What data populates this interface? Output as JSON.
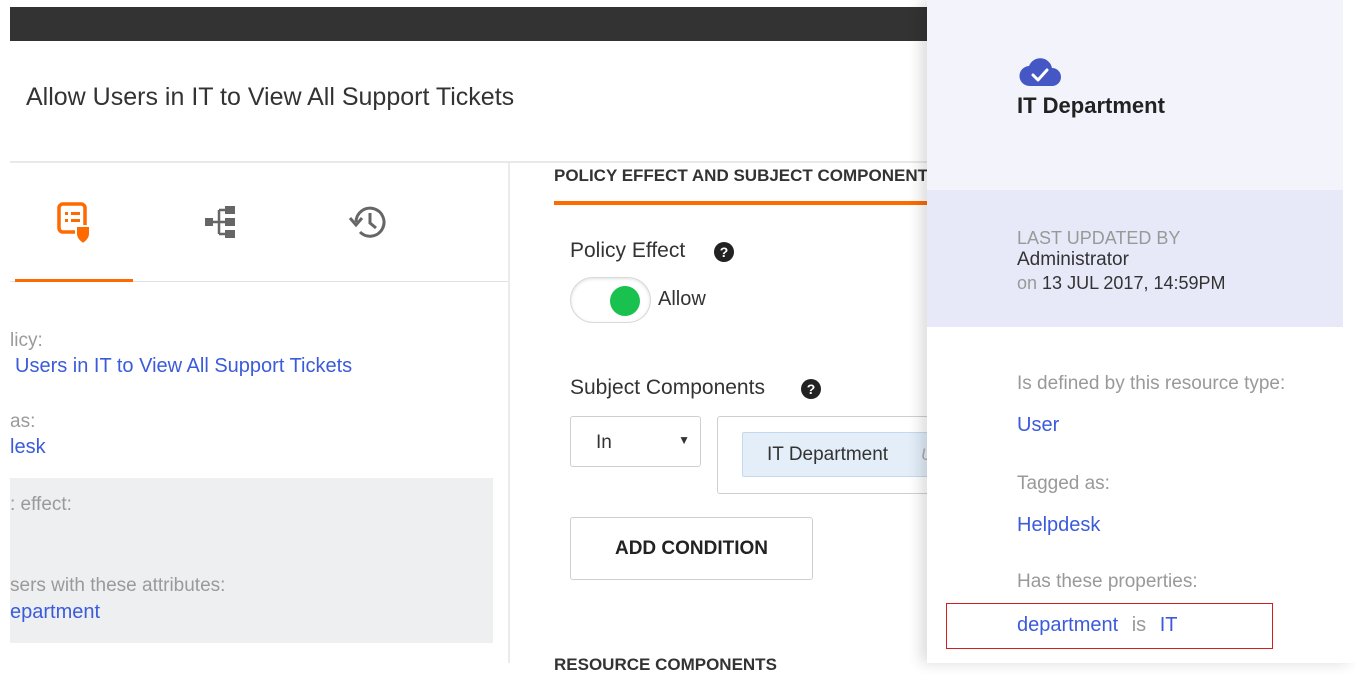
{
  "page": {
    "title": "Allow Users in IT to View All Support Tickets"
  },
  "left_panel": {
    "tabs": [
      {
        "icon": "policy-shield-icon",
        "active": true
      },
      {
        "icon": "hierarchy-icon",
        "active": false
      },
      {
        "icon": "history-icon",
        "active": false
      }
    ],
    "policy_label": "licy:",
    "policy_value": "Users in IT to View All Support Tickets",
    "tagged_label": "as:",
    "tagged_value": "lesk",
    "effect_label": ": effect:",
    "users_label": "sers with these attributes:",
    "users_value": "epartment"
  },
  "main": {
    "section_title": "POLICY EFFECT AND SUBJECT COMPONENTS",
    "policy_effect": {
      "label": "Policy Effect",
      "help": "?",
      "value": "Allow"
    },
    "subject_components": {
      "label": "Subject Components",
      "help": "?",
      "operator": "In",
      "caret": "▼",
      "chip_text": "IT Department",
      "chip_extra": "U"
    },
    "add_condition_label": "ADD CONDITION",
    "resource_components_title": "RESOURCE COMPONENTS"
  },
  "drawer": {
    "icon": "cloud-check-icon",
    "title": "IT Department",
    "last_updated_label": "LAST UPDATED BY",
    "updated_by": "Administrator",
    "on_label": "on",
    "updated_at": "13 JUL 2017, 14:59PM",
    "resource_type_label": "Is defined by this resource type:",
    "resource_type_value": "User",
    "tagged_label": "Tagged as:",
    "tagged_value": "Helpdesk",
    "properties_label": "Has these properties:",
    "property": {
      "name": "department",
      "operator": "is",
      "value": "IT"
    }
  },
  "colors": {
    "accent": "#ff6a00",
    "link": "#3b5bdb",
    "toggle_on": "#19c24f",
    "drawer_icon": "#4557c4",
    "highlight": "#d21e1e"
  }
}
